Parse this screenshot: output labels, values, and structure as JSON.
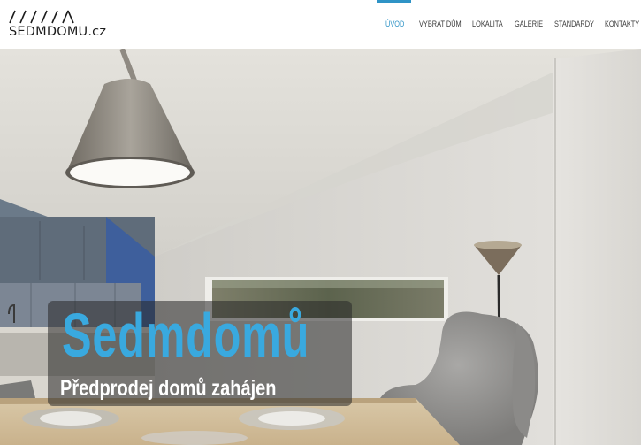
{
  "brand": {
    "logo_text": "SEDMDOMU.cz",
    "logo_mark": "//////\\",
    "accent_color": "#2e93c6"
  },
  "nav": {
    "items": [
      {
        "label": "ÚVOD",
        "active": true
      },
      {
        "label": "VYBRAT DŮM",
        "active": false
      },
      {
        "label": "LOKALITA",
        "active": false
      },
      {
        "label": "GALERIE",
        "active": false
      },
      {
        "label": "STANDARDY",
        "active": false
      },
      {
        "label": "KONTAKTY",
        "active": false
      }
    ]
  },
  "hero": {
    "image": "kitchen-dining-interior-render",
    "title": "Sedmdomů",
    "subtitle": "Předprodej domů zahájen",
    "title_color": "#39a9df"
  }
}
